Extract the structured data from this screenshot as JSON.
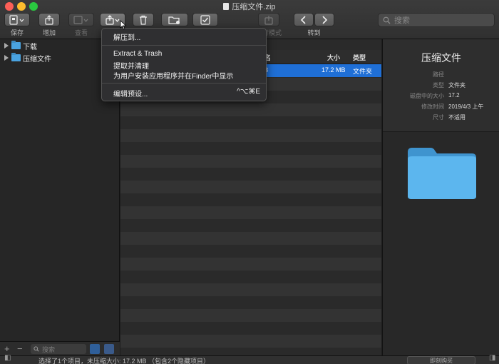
{
  "window": {
    "title": "压缩文件.zip"
  },
  "toolbar": {
    "save_label": "保存",
    "add_label": "增加",
    "view_label": "查看",
    "mode_label": "行模式",
    "goto_label": "转到"
  },
  "search": {
    "placeholder": "搜索"
  },
  "sidebar": {
    "items": [
      {
        "label": "下载"
      },
      {
        "label": "压缩文件"
      }
    ],
    "search_placeholder": "搜索"
  },
  "menu": {
    "items": [
      {
        "label": "解压到..."
      },
      {
        "label": "Extract & Trash"
      },
      {
        "label": "提取并清理"
      },
      {
        "label": "为用户安装应用程序并在Finder中显示"
      },
      {
        "label": "编辑预设...",
        "shortcut": "^⌥⌘E"
      }
    ]
  },
  "list": {
    "columns": {
      "name_partial": "名",
      "size": "大小",
      "type": "类型"
    },
    "rows": [
      {
        "name_partial": "3",
        "size": "17.2 MB",
        "type": "文件夹"
      }
    ]
  },
  "inspector": {
    "title": "压缩文件",
    "fields": [
      {
        "key": "路径",
        "value": ""
      },
      {
        "key": "类型",
        "value": "文件夹"
      },
      {
        "key": "磁盘中的大小",
        "value": "17.2"
      },
      {
        "key": "修改时间",
        "value": "2019/4/3 上午"
      },
      {
        "key": "尺寸",
        "value": "不适用"
      }
    ]
  },
  "status": {
    "text": "选择了1个项目，未压缩大小: 17.2 MB （包含2个隐藏项目）",
    "button_label": "即刻购买"
  },
  "colors": {
    "selection": "#1f6fd6",
    "folder": "#4aa3e0",
    "close": "#fc5f57",
    "minimize": "#fdbd2e",
    "zoom": "#2ac840"
  }
}
